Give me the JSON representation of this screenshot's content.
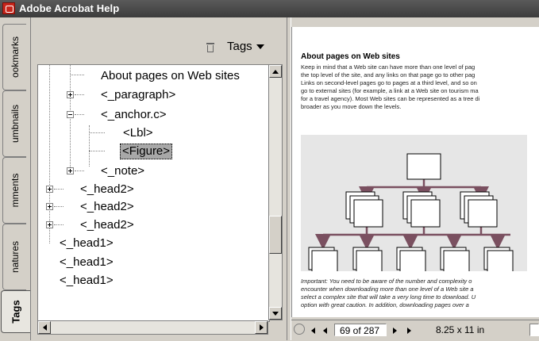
{
  "window": {
    "title": "Adobe Acrobat Help",
    "icon": "acrobat-icon"
  },
  "tabs": [
    {
      "label": "Bookmarks",
      "visible_text": "ookmarks"
    },
    {
      "label": "Thumbnails",
      "visible_text": "umbnails"
    },
    {
      "label": "Comments",
      "visible_text": "mments"
    },
    {
      "label": "Signatures",
      "visible_text": "natures"
    },
    {
      "label": "Tags",
      "visible_text": "Tags"
    }
  ],
  "panel": {
    "menu_label": "Tags",
    "delete_icon": "trash-icon"
  },
  "tree": [
    {
      "label": "About pages on Web sites"
    },
    {
      "label": "<_paragraph>"
    },
    {
      "label": "<_anchor.c>"
    },
    {
      "label": "<Lbl>"
    },
    {
      "label": "<Figure>",
      "selected": true
    },
    {
      "label": "<_note>"
    },
    {
      "label": "<_head2>"
    },
    {
      "label": "<_head2>"
    },
    {
      "label": "<_head2>"
    },
    {
      "label": "<_head1>"
    },
    {
      "label": "<_head1>"
    },
    {
      "label": "<_head1>"
    }
  ],
  "document": {
    "heading": "About pages on Web sites",
    "body": "Keep in mind that a Web site can have more than one level of pag\nthe top level of the site, and any links on that page go to other pag\nLinks on second-level pages go to pages at a third level, and so on\ngo to external sites (for example, a link at a Web site on tourism ma\nfor a travel agency). Most Web sites can be represented as a tree di\nbroader as you move down the levels.",
    "important": "Important: You need to be aware of the number and complexity o\nencounter when downloading more than one level of a Web site a\nselect a complex site that will take a very long time to download. U\noption with great caution. In addition, downloading pages over a"
  },
  "status": {
    "page_display": "69 of 287",
    "page_size": "8.25 x 11 in"
  },
  "colors": {
    "tree_arrow": "#7a5060",
    "selection": "#a8a8a8",
    "titlebar": "#4a4a4a"
  }
}
